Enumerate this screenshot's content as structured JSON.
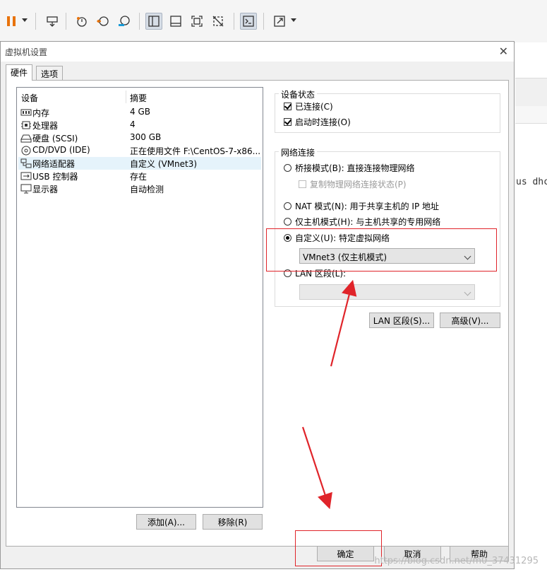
{
  "dialog": {
    "title": "虚拟机设置",
    "tabs": [
      "硬件",
      "选项"
    ]
  },
  "devices": {
    "header_device": "设备",
    "header_summary": "摘要",
    "rows": [
      {
        "name": "内存",
        "summary": "4 GB",
        "icon": "memory-icon"
      },
      {
        "name": "处理器",
        "summary": "4",
        "icon": "cpu-icon"
      },
      {
        "name": "硬盘 (SCSI)",
        "summary": "300 GB",
        "icon": "hard-disk-icon"
      },
      {
        "name": "CD/DVD (IDE)",
        "summary": "正在使用文件 F:\\CentOS-7-x86...",
        "icon": "cd-dvd-icon"
      },
      {
        "name": "网络适配器",
        "summary": "自定义 (VMnet3)",
        "icon": "network-adapter-icon",
        "selected": true
      },
      {
        "name": "USB 控制器",
        "summary": "存在",
        "icon": "usb-icon"
      },
      {
        "name": "显示器",
        "summary": "自动检测",
        "icon": "display-icon"
      }
    ],
    "add_button": "添加(A)...",
    "remove_button": "移除(R)"
  },
  "device_status": {
    "label": "设备状态",
    "connected": "已连接(C)",
    "connect_on_power": "启动时连接(O)"
  },
  "network": {
    "label": "网络连接",
    "bridged": "桥接模式(B): 直接连接物理网络",
    "replicate": "复制物理网络连接状态(P)",
    "nat": "NAT 模式(N): 用于共享主机的 IP 地址",
    "host_only": "仅主机模式(H): 与主机共享的专用网络",
    "custom": "自定义(U): 特定虚拟网络",
    "custom_value": "VMnet3 (仅主机模式)",
    "lan": "LAN 区段(L):",
    "lan_value": "",
    "lan_segments_button": "LAN 区段(S)...",
    "advanced_button": "高级(V)..."
  },
  "footer": {
    "ok": "确定",
    "cancel": "取消",
    "help": "帮助"
  },
  "background": {
    "terminal_text": "us dhc"
  },
  "watermark": "https://blog.csdn.net/m0_37431295",
  "colors": {
    "annotation_red": "#e0242a",
    "pause_orange": "#e8730c",
    "selection_blue": "#e5f3fb"
  }
}
